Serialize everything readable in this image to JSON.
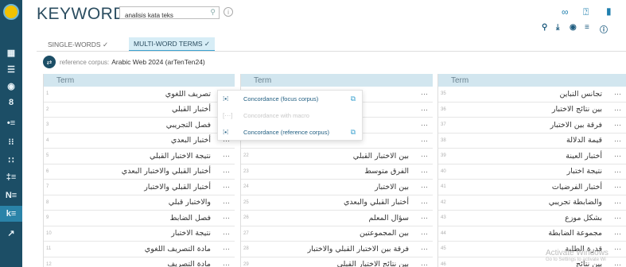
{
  "header": {
    "title": "KEYWORDS",
    "search_value": "analisis kata teks",
    "info_icon": "ⓘ"
  },
  "top_icons": [
    {
      "name": "link-icon",
      "glyph": "∞"
    },
    {
      "name": "help-icon",
      "glyph": "?"
    },
    {
      "name": "comment-icon",
      "glyph": "▮"
    }
  ],
  "tools": [
    {
      "name": "search-tool-icon",
      "glyph": "⚲"
    },
    {
      "name": "download-icon",
      "glyph": "⤓"
    },
    {
      "name": "visibility-icon",
      "glyph": "◉"
    },
    {
      "name": "filter-icon",
      "glyph": "≡"
    },
    {
      "name": "info-tool-icon",
      "glyph": "ⓘ"
    }
  ],
  "tabs": [
    {
      "label": "SINGLE-WORDS ✓",
      "active": false
    },
    {
      "label": "MULTI-WORD TERMS ✓",
      "active": true
    }
  ],
  "corpus": {
    "label": "reference corpus:",
    "value": "Arabic Web 2024 (arTenTen24)"
  },
  "table_header": "Term",
  "columns": [
    {
      "rows": [
        {
          "n": "1",
          "term": "تصريف اللغوي"
        },
        {
          "n": "2",
          "term": "أختبار القبلي"
        },
        {
          "n": "3",
          "term": "فصل التجريبي"
        },
        {
          "n": "4",
          "term": "أختبار البعدي"
        },
        {
          "n": "5",
          "term": "نتيجة الاختبار القبلي"
        },
        {
          "n": "6",
          "term": "أختبار القبلي والاختبار البعدي"
        },
        {
          "n": "7",
          "term": "أختبار القبلي والاختبار"
        },
        {
          "n": "8",
          "term": "والاختبار قبلي"
        },
        {
          "n": "9",
          "term": "فصل الضابط"
        },
        {
          "n": "10",
          "term": "نتيجة الاختبار"
        },
        {
          "n": "11",
          "term": "مادة التصريف اللغوي"
        },
        {
          "n": "12",
          "term": "مادة التصريف"
        }
      ]
    },
    {
      "rows": [
        {
          "n": "",
          "term": ""
        },
        {
          "n": "",
          "term": ""
        },
        {
          "n": "",
          "term": ""
        },
        {
          "n": "",
          "term": ""
        },
        {
          "n": "22",
          "term": "بين الاختبار القبلي"
        },
        {
          "n": "23",
          "term": "الفرق متوسط"
        },
        {
          "n": "24",
          "term": "بين الاختبار"
        },
        {
          "n": "25",
          "term": "أختبار القبلي والبعدي"
        },
        {
          "n": "26",
          "term": "سؤال المعلم"
        },
        {
          "n": "27",
          "term": "بين المجموعتين"
        },
        {
          "n": "28",
          "term": "فرقة بين الاختبار القبلي والاختبار"
        },
        {
          "n": "29",
          "term": "بين نتائج الاختبار القبلي"
        }
      ]
    },
    {
      "rows": [
        {
          "n": "35",
          "term": "تجانس التباين"
        },
        {
          "n": "36",
          "term": "بين نتائج الاختبار"
        },
        {
          "n": "37",
          "term": "فرقة بين الاختبار"
        },
        {
          "n": "38",
          "term": "قيمة الدلالة"
        },
        {
          "n": "39",
          "term": "أختبار العينة"
        },
        {
          "n": "40",
          "term": "نتيجة اختبار"
        },
        {
          "n": "41",
          "term": "أختبار الفرضيات"
        },
        {
          "n": "42",
          "term": "والضابطة تجريبي"
        },
        {
          "n": "43",
          "term": "بشكل موزع"
        },
        {
          "n": "44",
          "term": "مجموعة الضابطة"
        },
        {
          "n": "45",
          "term": "قدرة الطلبة"
        },
        {
          "n": "46",
          "term": "بين نتائج"
        }
      ]
    }
  ],
  "row_menu": "···",
  "popup": {
    "items": [
      {
        "label": "Concordance (focus corpus)",
        "enabled": true
      },
      {
        "label": "Concordance with macro",
        "enabled": false
      },
      {
        "label": "Concordance (reference corpus)",
        "enabled": true
      }
    ]
  },
  "watermark": {
    "line1": "Activate Windows",
    "line2": "Go to Settings to activate Wi"
  },
  "colors": {
    "sidebar": "#1c4e66",
    "accent": "#3ea3d0",
    "header_row": "#d2e6ef",
    "active_tab": "#d7edf6"
  }
}
